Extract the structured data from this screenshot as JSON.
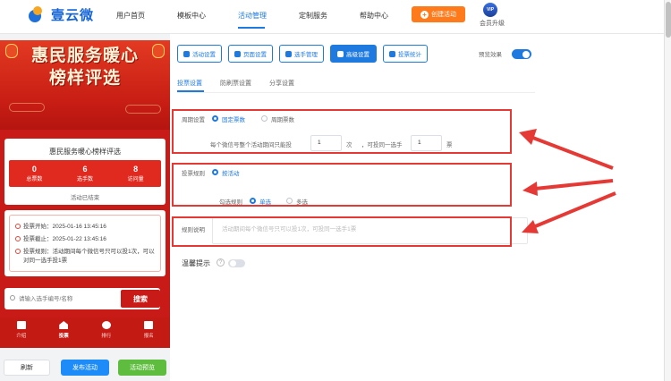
{
  "brand": {
    "logo_text": "壹云微"
  },
  "nav": {
    "items": [
      {
        "label": "用户首页"
      },
      {
        "label": "模板中心"
      },
      {
        "label": "活动管理"
      },
      {
        "label": "定制服务"
      },
      {
        "label": "帮助中心"
      }
    ],
    "create_button": "创建活动",
    "vip_badge": "VIP",
    "vip_label": "会员升级"
  },
  "preview": {
    "banner_title_line1": "惠民服务暖心",
    "banner_title_line2": "榜样评选",
    "card_title": "惠民服务暖心榜样评选",
    "stats": [
      {
        "value": "0",
        "label": "总票数"
      },
      {
        "value": "6",
        "label": "选手数"
      },
      {
        "value": "8",
        "label": "访问量"
      }
    ],
    "status": "活动已结束",
    "info": {
      "start": "投票开始：2025-01-16 13:45:16",
      "end": "投票截止：2025-01-22 13:45:16",
      "rule": "投票规则：活动期间每个微信号只可以投1次，可以对同一选手投1票"
    },
    "search_placeholder": "请输入选手编号/名称",
    "search_button": "搜索",
    "tabs": [
      {
        "label": "介绍"
      },
      {
        "label": "投票"
      },
      {
        "label": "排行"
      },
      {
        "label": "报名"
      }
    ]
  },
  "bottom_buttons": {
    "refresh": "刷新",
    "publish": "发布活动",
    "preview": "活动预览"
  },
  "toolbar": {
    "buttons": [
      {
        "label": "活动设置"
      },
      {
        "label": "页面设置"
      },
      {
        "label": "选手管理"
      },
      {
        "label": "高级设置"
      },
      {
        "label": "投票统计"
      }
    ],
    "preview_effect": "预览效果"
  },
  "subtabs": [
    {
      "label": "投票设置"
    },
    {
      "label": "防刷票设置"
    },
    {
      "label": "分享设置"
    }
  ],
  "period": {
    "label": "周期设置",
    "option_fixed": "固定票数",
    "option_cycle": "周期票数",
    "text_prefix": "每个微信号整个活动期间只能投",
    "count1": "1",
    "unit1": "次",
    "text_mid": "，可投同一选手",
    "count2": "1",
    "unit2": "票"
  },
  "vote_rule": {
    "label": "投票规则",
    "option": "按活动",
    "check_label": "勾选规则",
    "option_single": "单选",
    "option_multi": "多选"
  },
  "rule_desc": {
    "label": "规则说明",
    "placeholder": "活动期间每个微信号只可以投1次，可投同一选手1票"
  },
  "tip": {
    "label": "温馨提示",
    "help": "?"
  }
}
